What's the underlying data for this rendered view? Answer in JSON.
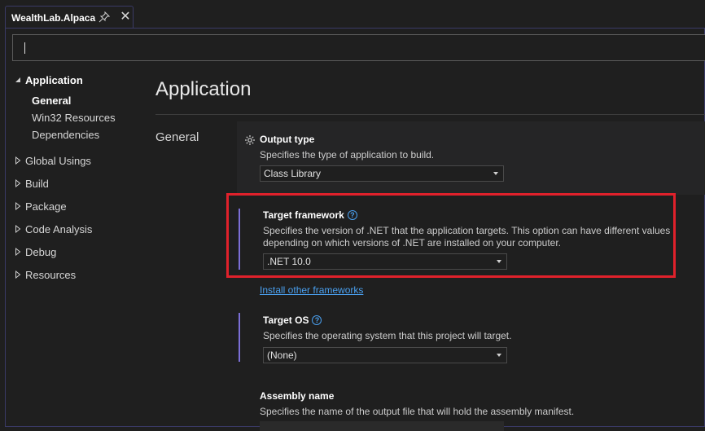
{
  "tab": {
    "title": "WealthLab.Alpaca",
    "pin_icon": "pin-icon",
    "close_icon": "close-icon"
  },
  "search": {
    "value": ""
  },
  "nav": {
    "application": "Application",
    "application_children": [
      "General",
      "Win32 Resources",
      "Dependencies"
    ],
    "items": [
      "Global Usings",
      "Build",
      "Package",
      "Code Analysis",
      "Debug",
      "Resources"
    ]
  },
  "page": {
    "title": "Application",
    "section": "General"
  },
  "output_type": {
    "title": "Output type",
    "desc": "Specifies the type of application to build.",
    "value": "Class Library"
  },
  "target_framework": {
    "title": "Target framework",
    "desc_line1": "Specifies the version of .NET that the application targets. This option can have different values",
    "desc_line2": "depending on which versions of .NET are installed on your computer.",
    "value": ".NET 10.0",
    "link": "Install other frameworks"
  },
  "target_os": {
    "title": "Target OS",
    "desc": "Specifies the operating system that this project will target.",
    "value": "(None)"
  },
  "assembly_name": {
    "title": "Assembly name",
    "desc": "Specifies the name of the output file that will hold the assembly manifest."
  },
  "colors": {
    "accent": "#7b6fd6",
    "link": "#4aa0f0",
    "highlight": "#e0212b",
    "background": "#1f1f1f"
  }
}
